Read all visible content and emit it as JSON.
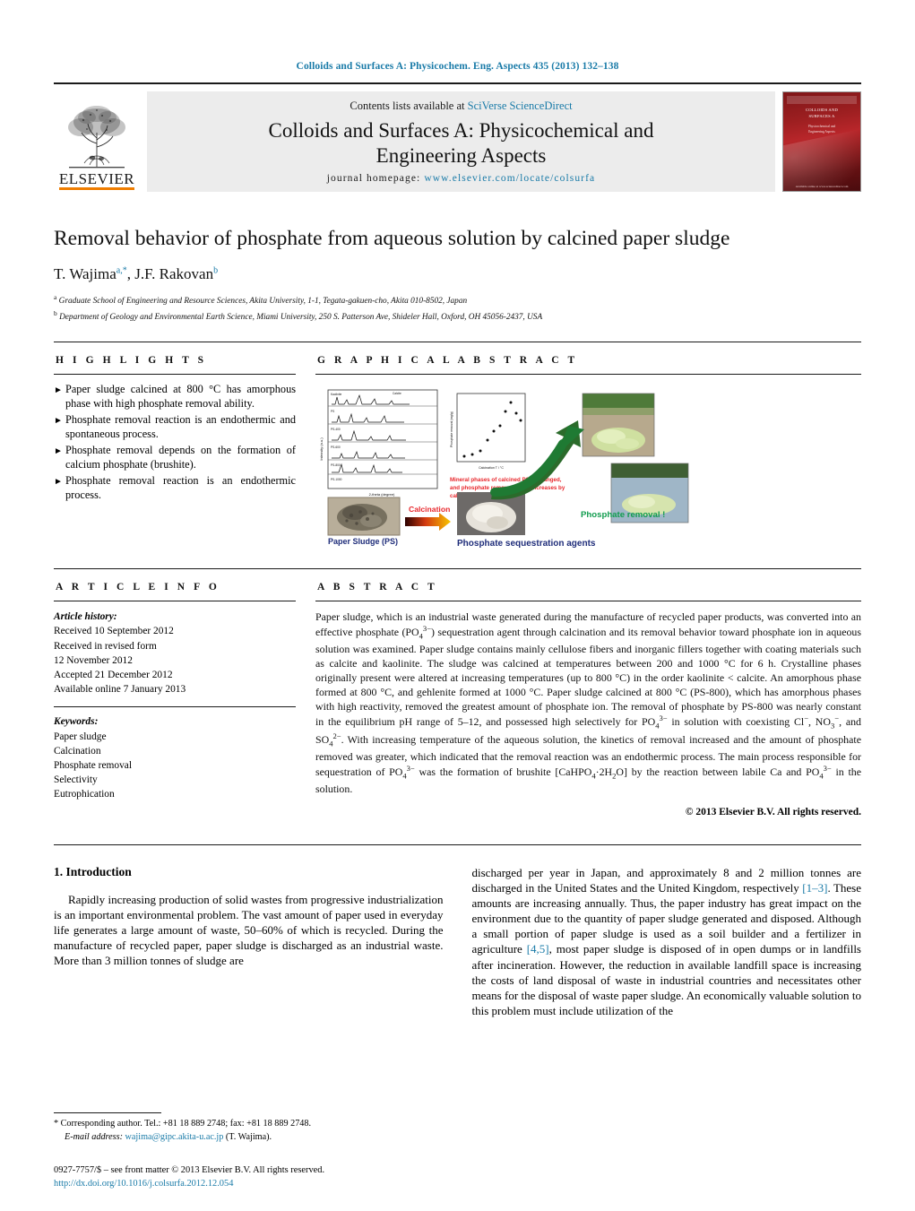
{
  "running_head": "Colloids and Surfaces A: Physicochem. Eng. Aspects 435 (2013) 132–138",
  "masthead": {
    "contents_prefix": "Contents lists available at ",
    "contents_link": "SciVerse ScienceDirect",
    "journal_title_line1": "Colloids and Surfaces A: Physicochemical and",
    "journal_title_line2": "Engineering Aspects",
    "homepage_label": "journal homepage:",
    "homepage_url": "www.elsevier.com/locate/colsurfa",
    "publisher": "ELSEVIER",
    "cover": {
      "title_line1": "COLLOIDS AND",
      "title_line2": "SURFACES A",
      "subtitle_line1": "Physicochemical and",
      "subtitle_line2": "Engineering Aspects",
      "footer": "Available online at www.sciencedirect.com"
    }
  },
  "article": {
    "title": "Removal behavior of phosphate from aqueous solution by calcined paper sludge",
    "authors": [
      {
        "name": "T. Wajima",
        "marks": "a,*"
      },
      {
        "name": "J.F. Rakovan",
        "marks": "b"
      }
    ],
    "affiliations": [
      {
        "mark": "a",
        "text": "Graduate School of Engineering and Resource Sciences, Akita University, 1-1, Tegata-gakuen-cho, Akita 010-8502, Japan"
      },
      {
        "mark": "b",
        "text": "Department of Geology and Environmental Earth Science, Miami University, 250 S. Patterson Ave, Shideler Hall, Oxford, OH 45056-2437, USA"
      }
    ]
  },
  "highlights": {
    "heading": "H I G H L I G H T S",
    "bullet_glyph": "►",
    "items": [
      "Paper sludge calcined at 800 °C has amorphous phase with high phosphate removal ability.",
      "Phosphate removal reaction is an endothermic and spontaneous process.",
      "Phosphate removal depends on the formation of calcium phosphate (brushite).",
      "Phosphate removal reaction is an endothermic process."
    ]
  },
  "graphical_abstract": {
    "heading": "G R A P H I C A L   A B S T R A C T",
    "caption_paper_sludge": "Paper Sludge (PS)",
    "caption_calcination": "Calcination",
    "caption_sequestration": "Phosphate sequestration agents",
    "caption_removal": "Phosphate removal !",
    "red_note_line1": "Mineral phases of calcined PS is changed,",
    "red_note_line2": "and phosphate removal ability increases by",
    "red_note_line3": "calcination.",
    "xrd_ylabel": "Intensity (a.u.)",
    "xrd_xlabel": "2-theta (degree)",
    "plot_ylabel": "Phosphate removal amount (mg/g)",
    "plot_xlabel": "Calcination T / °C",
    "colors": {
      "red_note": "#e8272c",
      "calcination_label": "#e8272c",
      "sequestration_label": "#1f2d7a",
      "removal_label": "#119c4e",
      "arrow_green": "#1f7a33",
      "arrow_orange": "#f5a623"
    }
  },
  "article_info": {
    "heading": "A R T I C L E    I N F O",
    "history_label": "Article history:",
    "history": [
      "Received 10 September 2012",
      "Received in revised form",
      "12 November 2012",
      "Accepted 21 December 2012",
      "Available online 7 January 2013"
    ],
    "keywords_label": "Keywords:",
    "keywords": [
      "Paper sludge",
      "Calcination",
      "Phosphate removal",
      "Selectivity",
      "Eutrophication"
    ]
  },
  "abstract": {
    "heading": "A B S T R A C T",
    "text_parts": [
      "Paper sludge, which is an industrial waste generated during the manufacture of recycled paper products, was converted into an effective phosphate (PO",
      "4",
      "3−",
      ") sequestration agent through calcination and its removal behavior toward phosphate ion in aqueous solution was examined. Paper sludge contains mainly cellulose fibers and inorganic fillers together with coating materials such as calcite and kaolinite. The sludge was calcined at temperatures between 200 and 1000 °C for 6 h. Crystalline phases originally present were altered at increasing temperatures (up to 800 °C) in the order kaolinite < calcite. An amorphous phase formed at 800 °C, and gehlenite formed at 1000 °C. Paper sludge calcined at 800 °C (PS-800), which has amorphous phases with high reactivity, removed the greatest amount of phosphate ion. The removal of phosphate by PS-800 was nearly constant in the equilibrium pH range of 5–12, and possessed high selectively for PO",
      "4",
      "3−",
      " in solution with coexisting Cl",
      "−",
      ", NO",
      "3",
      "−",
      ", and SO",
      "4",
      "2−",
      ". With increasing temperature of the aqueous solution, the kinetics of removal increased and the amount of phosphate removed was greater, which indicated that the removal reaction was an endothermic process. The main process responsible for sequestration of PO",
      "4",
      "3−",
      " was the formation of brushite [CaHPO",
      "4",
      "·2H",
      "2",
      "O] by the reaction between labile Ca and PO",
      "4",
      "3−",
      " in the solution."
    ],
    "copyright": "© 2013 Elsevier B.V. All rights reserved."
  },
  "body": {
    "section_number_title": "1.  Introduction",
    "left_paragraph": "Rapidly increasing production of solid wastes from progressive industrialization is an important environmental problem. The vast amount of paper used in everyday life generates a large amount of waste, 50–60% of which is recycled. During the manufacture of recycled paper, paper sludge is discharged as an industrial waste. More than 3 million tonnes of sludge are",
    "right_paragraph_part1": "discharged per year in Japan, and approximately 8 and 2 million tonnes are discharged in the United States and the United Kingdom, respectively ",
    "right_ref1": "[1–3]",
    "right_paragraph_part2": ". These amounts are increasing annually. Thus, the paper industry has great impact on the environment due to the quantity of paper sludge generated and disposed. Although a small portion of paper sludge is used as a soil builder and a fertilizer in agriculture ",
    "right_ref2": "[4,5]",
    "right_paragraph_part3": ", most paper sludge is disposed of in open dumps or in landfills after incineration. However, the reduction in available landfill space is increasing the costs of land disposal of waste in industrial countries and necessitates other means for the disposal of waste paper sludge. An economically valuable solution to this problem must include utilization of the"
  },
  "footnote": {
    "star": "*",
    "corresponding": "Corresponding author. Tel.: +81 18 889 2748; fax: +81 18 889 2748.",
    "email_label": "E-mail address:",
    "email": "wajima@gipc.akita-u.ac.jp",
    "email_owner": "(T. Wajima)."
  },
  "imprint": {
    "line1": "0927-7757/$ – see front matter © 2013 Elsevier B.V. All rights reserved.",
    "doi": "http://dx.doi.org/10.1016/j.colsurfa.2012.12.054"
  },
  "colors": {
    "link": "#1a7ba8",
    "rule": "#1a1a1a",
    "masthead_bg": "#ececec",
    "elsevier_orange": "#ef7d00"
  }
}
